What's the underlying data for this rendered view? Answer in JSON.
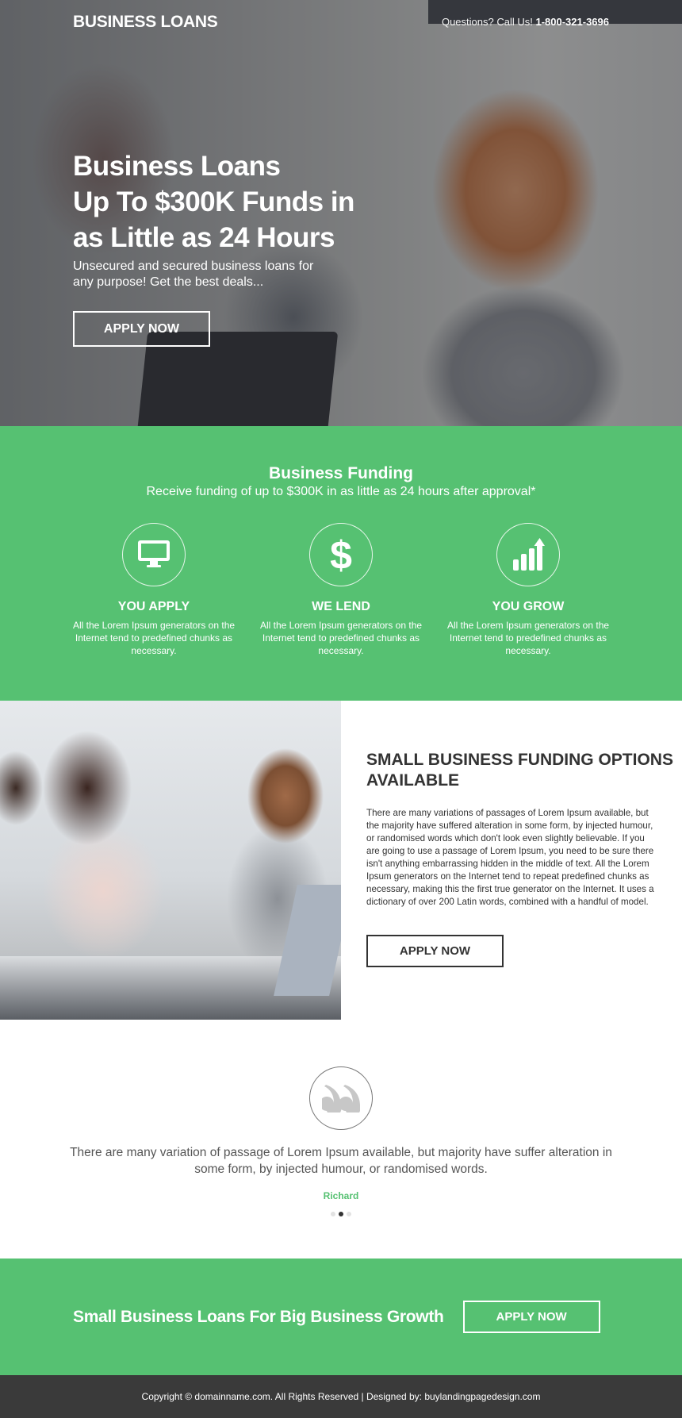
{
  "header": {
    "logo": "BUSINESS LOANS",
    "phone_prefix": "Questions? Call Us!",
    "phone_number": "1-800-321-3696"
  },
  "hero": {
    "title_line1": "Business Loans",
    "title_line2": "Up To $300K Funds in",
    "title_line3": "as Little as 24 Hours",
    "subtitle": "Unsecured and secured business loans for any purpose! Get the best deals...",
    "cta_label": "APPLY NOW"
  },
  "features": {
    "title": "Business Funding",
    "subtitle": "Receive funding of up to $300K in as little as 24 hours after approval*",
    "items": [
      {
        "icon": "monitor-icon",
        "name": "YOU APPLY",
        "desc": "All the Lorem Ipsum generators on the Internet tend to predefined chunks as necessary."
      },
      {
        "icon": "dollar-icon",
        "name": "WE LEND",
        "desc": "All the Lorem Ipsum generators on the Internet tend to predefined chunks as necessary."
      },
      {
        "icon": "growth-chart-icon",
        "name": "YOU GROW",
        "desc": "All the Lorem Ipsum generators on the Internet tend to predefined chunks as necessary."
      }
    ]
  },
  "options": {
    "title": "SMALL BUSINESS FUNDING OPTIONS AVAILABLE",
    "body": "There are many variations of passages of Lorem Ipsum available, but the majority have suffered alteration in some form, by injected humour, or randomised words which don't look even slightly believable. If you are going to use a passage of Lorem Ipsum, you need to be sure there isn't anything embarrassing hidden in the middle of text. All the Lorem Ipsum generators on the Internet tend to repeat predefined chunks as necessary, making this the first true generator on the Internet. It uses a dictionary of over 200 Latin words, combined with a handful of model.",
    "cta_label": "APPLY NOW"
  },
  "testimonial": {
    "quote": "There are many variation of passage of Lorem Ipsum available, but majority have suffer alteration in some form, by injected humour, or randomised words.",
    "author": "Richard",
    "slides_total": 3,
    "active_slide": 2
  },
  "cta": {
    "title": "Small Business Loans For Big Business Growth",
    "button_label": "APPLY NOW"
  },
  "footer": {
    "text": "Copyright © domainname.com. All Rights Reserved | Designed by: buylandingpagedesign.com"
  },
  "colors": {
    "accent_green": "#56c172",
    "footer_bg": "#3a3a3a",
    "text_dark": "#333333"
  }
}
